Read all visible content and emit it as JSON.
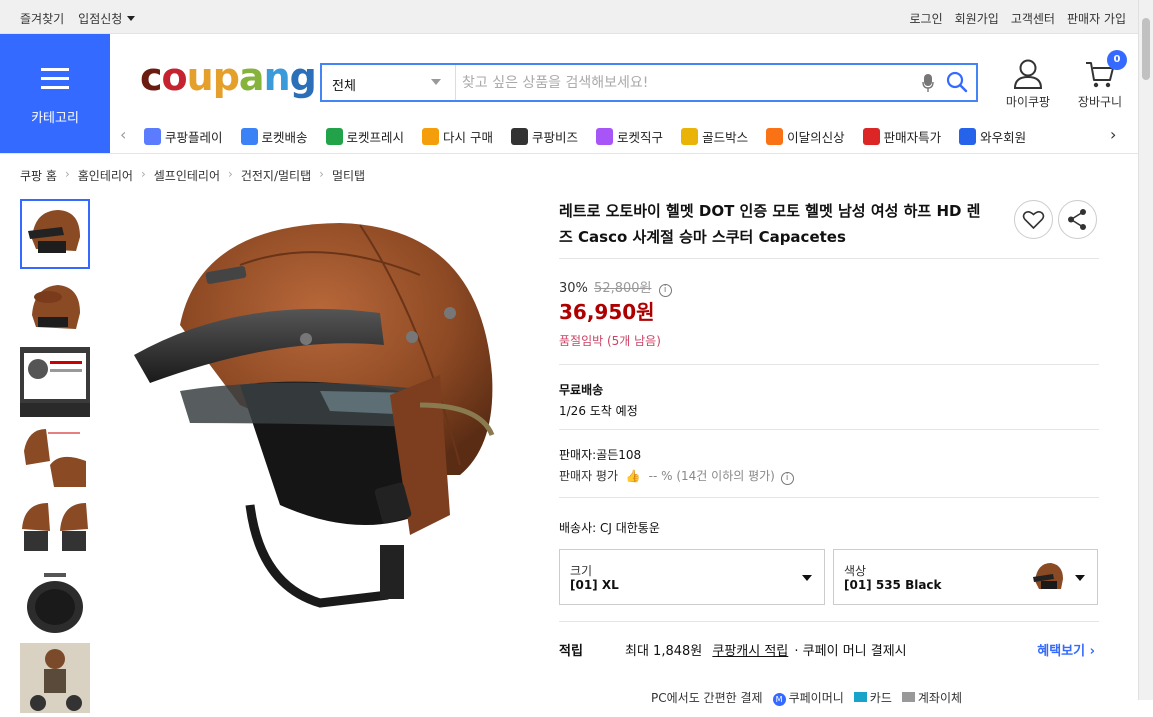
{
  "topbar": {
    "left": [
      "즐겨찾기",
      "입점신청"
    ],
    "right": [
      "로그인",
      "회원가입",
      "고객센터",
      "판매자 가입"
    ]
  },
  "header": {
    "category_label": "카테고리",
    "logo_letters": [
      "c",
      "o",
      "u",
      "p",
      "a",
      "n",
      "g"
    ],
    "search": {
      "category": "전체",
      "placeholder": "찾고 싶은 상품을 검색해보세요!"
    },
    "mycoupang": "마이쿠팡",
    "cart": "장바구니",
    "cart_count": "0"
  },
  "quicknav": [
    {
      "label": "쿠팡플레이",
      "icon": "play-icon",
      "color": "#5b7cff"
    },
    {
      "label": "로켓배송",
      "icon": "rocket-icon",
      "color": "#3b82f6"
    },
    {
      "label": "로켓프레시",
      "icon": "rocket-fresh-icon",
      "color": "#22a34a"
    },
    {
      "label": "다시 구매",
      "icon": "rebuy-icon",
      "color": "#f59e0b"
    },
    {
      "label": "쿠팡비즈",
      "icon": "biz-icon",
      "color": "#333333"
    },
    {
      "label": "로켓직구",
      "icon": "rocket-global-icon",
      "color": "#a855f7"
    },
    {
      "label": "골드박스",
      "icon": "goldbox-icon",
      "color": "#eab308"
    },
    {
      "label": "이달의신상",
      "icon": "new-icon",
      "color": "#f97316"
    },
    {
      "label": "판매자특가",
      "icon": "percent-icon",
      "color": "#dc2626"
    },
    {
      "label": "와우회원",
      "icon": "wow-icon",
      "color": "#2563eb"
    }
  ],
  "breadcrumb": [
    "쿠팡 홈",
    "홈인테리어",
    "셀프인테리어",
    "건전지/멀티탭",
    "멀티탭"
  ],
  "product": {
    "title": "레트로 오토바이 헬멧 DOT 인증 모토 헬멧 남성 여성 하프 HD 렌즈 Casco 사계절 승마 스쿠터 Capacetes",
    "discount": "30%",
    "original_price": "52,800원",
    "price": "36,950원",
    "stock_note": "품절임박 (5개 남음)",
    "shipping_title": "무료배송",
    "delivery": "1/26 도착 예정",
    "seller": "판매자:골든108",
    "seller_rating_label": "판매자 평가",
    "seller_rating_value": "-- %",
    "seller_rating_note": "(14건 이하의 평가)",
    "carrier": "배송사:  CJ 대한통운",
    "options": {
      "size_label": "크기",
      "size_value": "[01] XL",
      "color_label": "색상",
      "color_value": "[01] 535 Black"
    },
    "reward": {
      "label": "적립",
      "text_prefix": "최대 1,848원",
      "link": "쿠팡캐시 적립",
      "text_suffix": "· 쿠페이 머니 결제시",
      "more": "혜택보기"
    },
    "paybar": [
      "PC에서도 간편한 결제",
      "쿠페이머니",
      "카드",
      "계좌이체"
    ]
  }
}
